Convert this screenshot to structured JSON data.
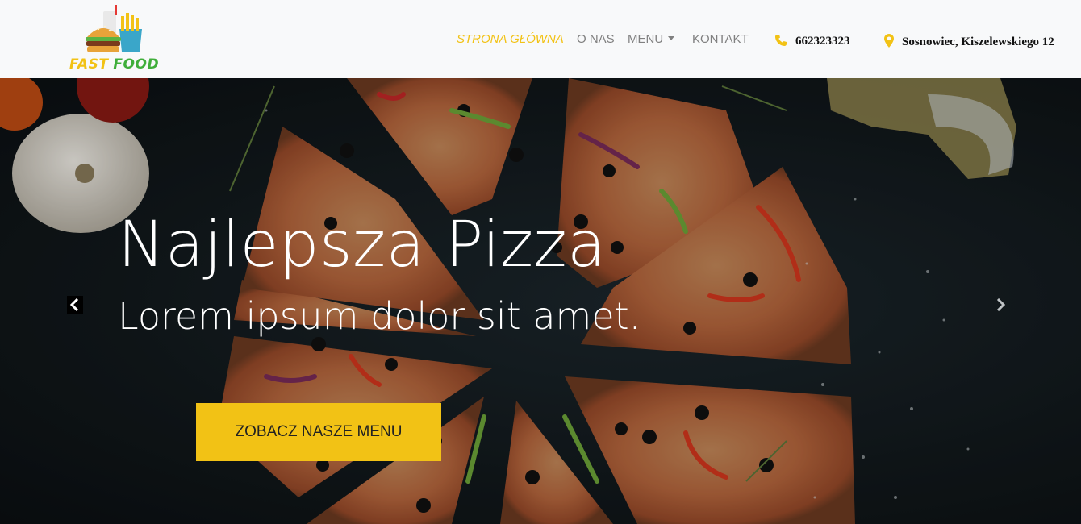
{
  "brand": {
    "word1": "FAST",
    "word2": "FOOD"
  },
  "nav": {
    "items": [
      {
        "label": "STRONA GŁÓWNA",
        "active": true
      },
      {
        "label": "O NAS"
      },
      {
        "label": "MENU",
        "dropdown": true
      },
      {
        "label": "KONTAKT"
      }
    ]
  },
  "contact": {
    "phone": "662323323",
    "address": "Sosnowiec, Kiszelewskiego 12",
    "phone_icon": "phone-icon",
    "address_icon": "map-marker-icon"
  },
  "hero": {
    "title": "Najlepsza Pizza",
    "subtitle": "Lorem ipsum dolor sit amet.",
    "cta_label": "ZOBACZ NASZE MENU"
  },
  "colors": {
    "accent": "#f2c215",
    "nav_text": "#808080",
    "header_bg": "#f8f9fa",
    "brand_green": "#3fae3a"
  }
}
